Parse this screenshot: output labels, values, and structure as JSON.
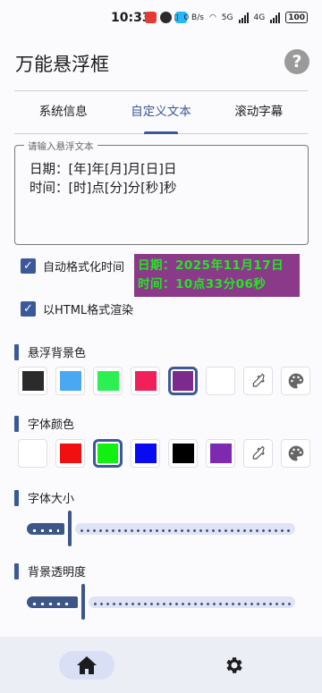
{
  "status_bar": {
    "time": "10:33",
    "network_speed": "0 B/s",
    "net_type_1": "5G",
    "net_type_2": "4G",
    "battery": "100"
  },
  "app": {
    "title": "万能悬浮框",
    "help_icon": "question-circle-icon",
    "help_glyph": "?"
  },
  "tabs": [
    {
      "label": "系统信息",
      "active": false
    },
    {
      "label": "自定义文本",
      "active": true
    },
    {
      "label": "滚动字幕",
      "active": false
    }
  ],
  "text_field": {
    "label": "请输入悬浮文本",
    "value": "日期：[年]年[月]月[日]日\n时间：[时]点[分]分[秒]秒"
  },
  "options": {
    "auto_format": {
      "label": "自动格式化时间",
      "checked": true
    },
    "html_render": {
      "label": "以HTML格式渲染",
      "checked": true
    },
    "check_glyph": "✓"
  },
  "preview": {
    "text": "日期：2025年11月17日\n时间：10点33分06秒",
    "background": "#8b3a8a",
    "color": "#22e622"
  },
  "background_color": {
    "label": "悬浮背景色",
    "swatches": [
      "#2b2b2b",
      "#4aa8f0",
      "#2cf052",
      "#f0205a",
      "#7d2a8d",
      "#ffffff"
    ],
    "selected_index": 4,
    "eyedropper_icon": "eyedropper-icon",
    "palette_icon": "palette-icon"
  },
  "font_color": {
    "label": "字体颜色",
    "swatches": [
      "#ffffff",
      "#f01010",
      "#12f012",
      "#0a0af0",
      "#000000",
      "#7d2ab0"
    ],
    "selected_index": 2,
    "eyedropper_icon": "eyedropper-icon",
    "palette_icon": "palette-icon"
  },
  "font_size": {
    "label": "字体大小",
    "value_fraction": 0.16
  },
  "bg_opacity": {
    "label": "背景透明度",
    "value_fraction": 0.21
  },
  "bottom_nav": {
    "home_icon": "home-icon",
    "settings_icon": "gear-icon",
    "active": "home"
  },
  "colors": {
    "accent": "#3b5998",
    "slider": "#3d5587"
  }
}
